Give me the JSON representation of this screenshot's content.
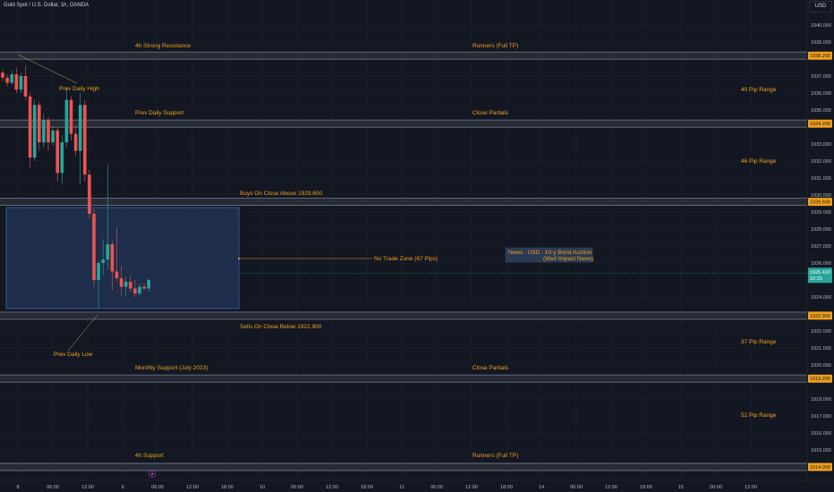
{
  "header": {
    "symbol": "Gold Spot / U.S. Dollar, 1h, OANDA",
    "currency_button": "USD"
  },
  "chart_data": {
    "type": "candlestick",
    "title": "Gold Spot / U.S. Dollar, 1h, OANDA",
    "ylim": [
      1913.4,
      1940.8
    ],
    "y_ticks": [
      "1940.000",
      "1939.000",
      "1937.000",
      "1936.000",
      "1935.000",
      "1933.000",
      "1932.000",
      "1931.000",
      "1930.000",
      "1929.000",
      "1928.000",
      "1927.000",
      "1926.000",
      "1924.000",
      "1923.000",
      "1922.000",
      "1921.000",
      "1920.000",
      "1918.000",
      "1917.000",
      "1916.000",
      "1915.000"
    ],
    "x_ticks": [
      "8",
      "06:00",
      "12:00",
      "9",
      "06:00",
      "12:00",
      "18:00",
      "10",
      "06:00",
      "12:00",
      "18:00",
      "11",
      "06:00",
      "12:00",
      "18:00",
      "14",
      "06:00",
      "12:00",
      "18:00",
      "15",
      "06:00",
      "12:00"
    ],
    "candles": [
      {
        "o": 1937.2,
        "h": 1937.4,
        "l": 1936.7,
        "c": 1936.9
      },
      {
        "o": 1936.9,
        "h": 1937.1,
        "l": 1936.4,
        "c": 1936.6
      },
      {
        "o": 1936.6,
        "h": 1937.3,
        "l": 1936.5,
        "c": 1937.1
      },
      {
        "o": 1937.1,
        "h": 1937.5,
        "l": 1936.0,
        "c": 1936.2
      },
      {
        "o": 1936.2,
        "h": 1937.2,
        "l": 1936.0,
        "c": 1937.0
      },
      {
        "o": 1937.0,
        "h": 1937.6,
        "l": 1935.6,
        "c": 1935.8
      },
      {
        "o": 1935.8,
        "h": 1936.0,
        "l": 1931.6,
        "c": 1932.2
      },
      {
        "o": 1932.2,
        "h": 1935.6,
        "l": 1932.0,
        "c": 1935.3
      },
      {
        "o": 1935.3,
        "h": 1935.5,
        "l": 1932.6,
        "c": 1933.1
      },
      {
        "o": 1933.1,
        "h": 1934.8,
        "l": 1932.8,
        "c": 1934.4
      },
      {
        "o": 1934.4,
        "h": 1934.6,
        "l": 1932.6,
        "c": 1933.1
      },
      {
        "o": 1933.1,
        "h": 1934.1,
        "l": 1932.9,
        "c": 1933.8
      },
      {
        "o": 1933.8,
        "h": 1934.0,
        "l": 1930.8,
        "c": 1931.3
      },
      {
        "o": 1931.3,
        "h": 1933.5,
        "l": 1930.6,
        "c": 1933.1
      },
      {
        "o": 1933.1,
        "h": 1936.3,
        "l": 1932.8,
        "c": 1935.6
      },
      {
        "o": 1935.6,
        "h": 1935.8,
        "l": 1933.2,
        "c": 1933.6
      },
      {
        "o": 1933.6,
        "h": 1934.1,
        "l": 1932.3,
        "c": 1932.6
      },
      {
        "o": 1932.6,
        "h": 1936.0,
        "l": 1930.6,
        "c": 1935.3
      },
      {
        "o": 1935.3,
        "h": 1935.6,
        "l": 1930.8,
        "c": 1931.2
      },
      {
        "o": 1931.2,
        "h": 1931.5,
        "l": 1928.6,
        "c": 1928.9
      },
      {
        "o": 1928.9,
        "h": 1929.2,
        "l": 1924.6,
        "c": 1925.0
      },
      {
        "o": 1925.0,
        "h": 1926.1,
        "l": 1923.3,
        "c": 1926.0
      },
      {
        "o": 1926.0,
        "h": 1927.4,
        "l": 1925.3,
        "c": 1926.2
      },
      {
        "o": 1926.2,
        "h": 1931.8,
        "l": 1925.6,
        "c": 1927.1
      },
      {
        "o": 1927.1,
        "h": 1927.3,
        "l": 1924.4,
        "c": 1925.5
      },
      {
        "o": 1925.5,
        "h": 1928.1,
        "l": 1924.9,
        "c": 1925.1
      },
      {
        "o": 1925.1,
        "h": 1925.8,
        "l": 1924.1,
        "c": 1924.6
      },
      {
        "o": 1924.6,
        "h": 1925.2,
        "l": 1924.0,
        "c": 1924.9
      },
      {
        "o": 1924.9,
        "h": 1925.3,
        "l": 1924.3,
        "c": 1924.5
      },
      {
        "o": 1924.5,
        "h": 1925.0,
        "l": 1924.0,
        "c": 1924.2
      },
      {
        "o": 1924.2,
        "h": 1924.8,
        "l": 1924.1,
        "c": 1924.6
      },
      {
        "o": 1924.6,
        "h": 1924.8,
        "l": 1924.4,
        "c": 1924.5
      },
      {
        "o": 1924.5,
        "h": 1925.1,
        "l": 1924.3,
        "c": 1925.0
      }
    ],
    "levels": [
      {
        "name": "4h Strong Resistance",
        "value": 1938.2,
        "badge": "1938.200"
      },
      {
        "name": "Prev Daily Support",
        "value": 1934.2,
        "badge": "1934.200"
      },
      {
        "name": "Buys On Close Above 1929.600",
        "value": 1929.6,
        "badge": "1929.600"
      },
      {
        "name": "Sells On Close Below 1922.900",
        "value": 1922.9,
        "badge": "1922.900"
      },
      {
        "name": "Monthly Support (July 2023)",
        "value": 1919.2,
        "badge": "1919.200"
      },
      {
        "name": "4h Support",
        "value": 1914.0,
        "badge": "1914.000"
      }
    ],
    "current_price": {
      "value": 1925.41,
      "label": "1925.410",
      "countdown": "22:33",
      "color": "#26a69a"
    },
    "no_trade_zone": {
      "top": 1929.6,
      "bottom": 1922.9
    }
  },
  "annotations": {
    "level_labels": [
      "4h Strong Resistance",
      "Prev Daily Support",
      "Buys On Close Above 1929.600",
      "Sells On Close Below 1922.900",
      "Monthly Support (July 2023)",
      "4h Support"
    ],
    "right_labels": [
      "Runners (Full TP)",
      "Close Partials",
      "Close Partials",
      "Runners (Full TP)"
    ],
    "ranges": [
      "40 Pip Range",
      "46 Pip Range",
      "37 Pip Range",
      "52 Pip Range"
    ],
    "prev_daily_high": "Prev Daily High",
    "prev_daily_low": "Prev Daily Low",
    "no_trade_zone": "No Trade Zone (67 Pips)",
    "news_line1": "News : USD : 10-y Bond Auction",
    "news_line2": "(Med Impact News)"
  },
  "colors": {
    "background": "#131722",
    "up": "#26a69a",
    "down": "#ef5350",
    "label": "#f0a11c",
    "level": "#6e7180",
    "zone": "#1e2f4d",
    "zone_border": "#3d6fb8"
  }
}
